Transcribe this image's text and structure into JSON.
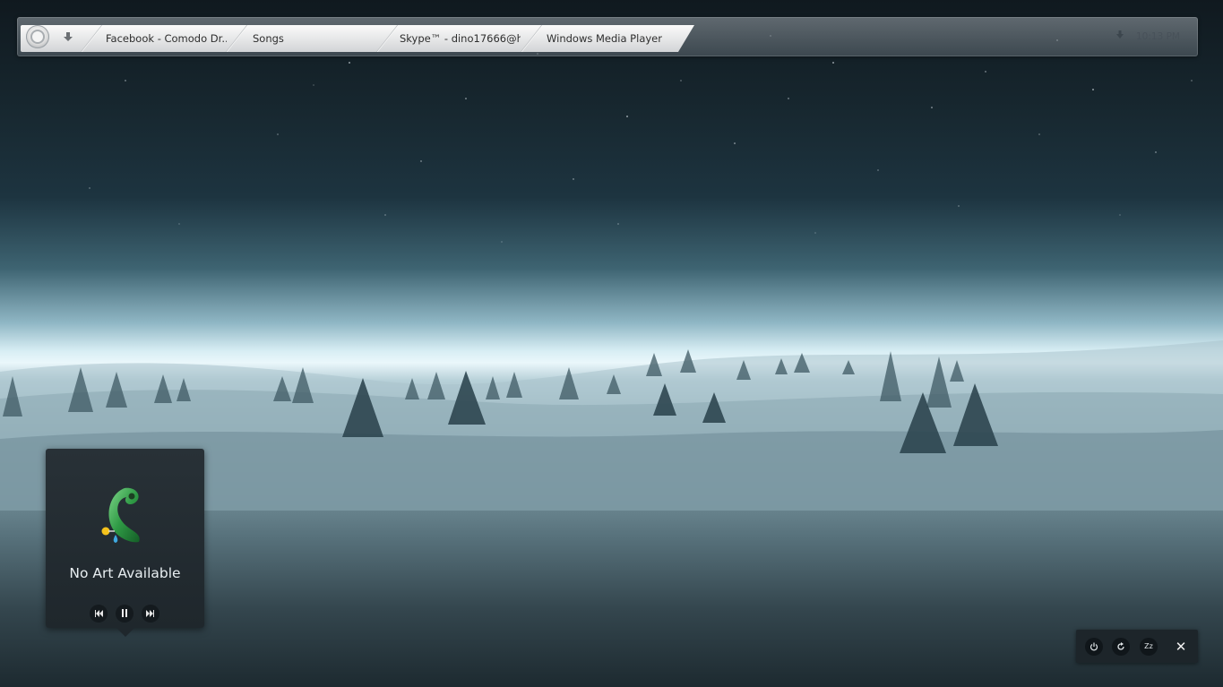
{
  "taskbar": {
    "tasks": [
      {
        "label": "Facebook - Comodo Dr..."
      },
      {
        "label": "Songs"
      },
      {
        "label": "Skype™ - dino17666@h..."
      },
      {
        "label": "Windows Media Player"
      }
    ],
    "clock": "10:13 PM"
  },
  "media_player": {
    "art_text": "No Art Available",
    "controls": [
      "previous",
      "pause",
      "next"
    ]
  },
  "power_panel": {
    "sleep_label": "Zz",
    "close_label": "✕"
  },
  "icons": {
    "start": "start-orb-icon",
    "show_desktop": "down-arrow-icon",
    "tray": "tray-arrow-icon",
    "power": "power-icon",
    "restart": "restart-icon",
    "sleep": "sleep-icon",
    "close": "close-icon"
  }
}
